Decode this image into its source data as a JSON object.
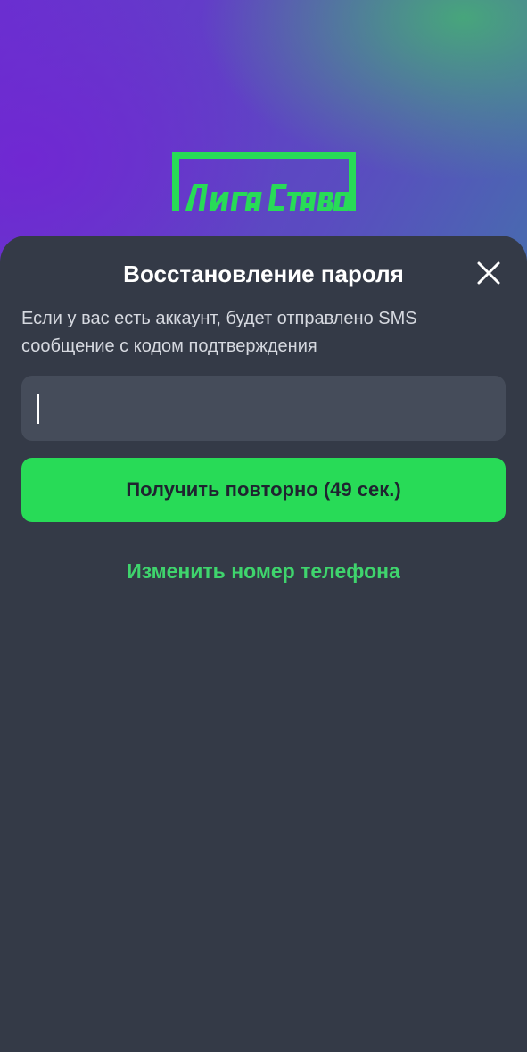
{
  "brand": {
    "logo_text": "Лига Ставок",
    "accent_color": "#28db57"
  },
  "dialog": {
    "title": "Восстановление пароля",
    "close_icon": "close-icon",
    "description": "Если у вас есть аккаунт, будет отправлено SMS сообщение с кодом подтверждения",
    "code_input": {
      "value": "",
      "placeholder": ""
    },
    "resend_button_label": "Получить повторно (49 сек.)",
    "change_phone_link": "Изменить номер телефона"
  },
  "colors": {
    "sheet_background": "#343a47",
    "input_background": "#454c5a",
    "button_background": "#28db57",
    "link_color": "#3fd46d"
  }
}
